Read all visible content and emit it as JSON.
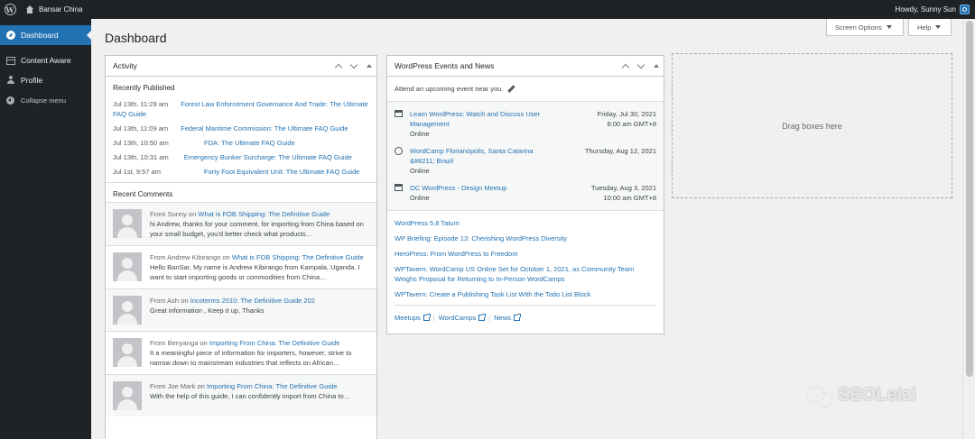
{
  "adminbar": {
    "site_name": "Bansar China",
    "howdy": "Howdy, Sunny Sun"
  },
  "sidebar": {
    "items": [
      {
        "label": "Dashboard",
        "icon": "dashboard-icon"
      },
      {
        "label": "Content Aware",
        "icon": "grid-icon"
      },
      {
        "label": "Profile",
        "icon": "user-icon"
      }
    ],
    "collapse_label": "Collapse menu"
  },
  "page": {
    "title": "Dashboard",
    "screen_options": "Screen Options",
    "help": "Help"
  },
  "activity": {
    "title": "Activity",
    "recently_published_heading": "Recently Published",
    "published": [
      {
        "date": "Jul 13th, 11:29 am",
        "title": "Forest Law Enforcement Governance And Trade: The Ultimate FAQ Guide"
      },
      {
        "date": "Jul 13th, 11:09 am",
        "title": "Federal Maritime Commission: The Ultimate FAQ Guide"
      },
      {
        "date": "Jul 13th, 10:50 am",
        "title": "FDA: The Ultimate FAQ Guide"
      },
      {
        "date": "Jul 13th, 10:31 am",
        "title": "Emergency Bunker Surcharge: The Ultimate FAQ Guide"
      },
      {
        "date": "Jul 1st, 9:57 am",
        "title": "Forty Foot Equivalent Unit: The Ultimate FAQ Guide"
      }
    ],
    "recent_comments_heading": "Recent Comments",
    "comments": [
      {
        "from": "From Sunny on ",
        "post": "What is FOB Shipping: The Definitive Guide",
        "text": "hi Andrew, thanks for your comment. for importing from China based on your small budget, you'd better check what products…"
      },
      {
        "from": "From Andrew Kibirango on ",
        "post": "What is FOB Shipping: The Definitive Guide",
        "text": "Hello BanSar, My name is Andrew Kibirango from Kampala, Uganda. I want to start importing goods or commodities from China…"
      },
      {
        "from": "From Ash on ",
        "post": "Incoterms 2010: The Definitive Guide 202",
        "text": "Great information , Keep it up, Thanks"
      },
      {
        "from": "From Benyanga on ",
        "post": "Importing From China: The Definitive Guide",
        "text": "It a meaningful piece of information for importers, however, strive to narrow down to mainstream industries that reflects on African…"
      },
      {
        "from": "From Joe Mark on ",
        "post": "Importing From China: The Definitive Guide",
        "text": "With the help of this guide, I can confidently import from China to…"
      }
    ]
  },
  "events": {
    "title": "WordPress Events and News",
    "intro": "Attend an upcoming event near you.",
    "items": [
      {
        "type": "meetup",
        "title": "Learn WordPress: Watch and Discuss User Management",
        "location": "Online",
        "date": "Friday, Jul 30, 2021",
        "time": "6:00 am GMT+8"
      },
      {
        "type": "wordcamp",
        "title": "WordCamp Florianópolis, Santa Catarina &#8211; Brazil",
        "location": "Online",
        "date": "Thursday, Aug 12, 2021",
        "time": ""
      },
      {
        "type": "meetup",
        "title": "OC WordPress - Design Meetup",
        "location": "Online",
        "date": "Tuesday, Aug 3, 2021",
        "time": "10:00 am GMT+8"
      }
    ],
    "news": [
      "WordPress 5.8 Tatum",
      "WP Briefing: Episode 13: Cherishing WordPress Diversity",
      "HeroPress: From WordPress to Freedom",
      "WPTavern: WordCamp US Online Set for October 1, 2021, as Community Team Weighs Proposal for Returning to In-Person WordCamps",
      "WPTavern: Create a Publishing Task List With the Todo List Block"
    ],
    "footer_links": [
      "Meetups",
      "WordCamps",
      "News"
    ]
  },
  "dropzone": {
    "label": "Drag boxes here"
  },
  "watermark": {
    "text": "SEOLeizi"
  },
  "colors": {
    "accent": "#2271b1",
    "adminbar": "#1d2327",
    "background": "#f0f0f1"
  }
}
